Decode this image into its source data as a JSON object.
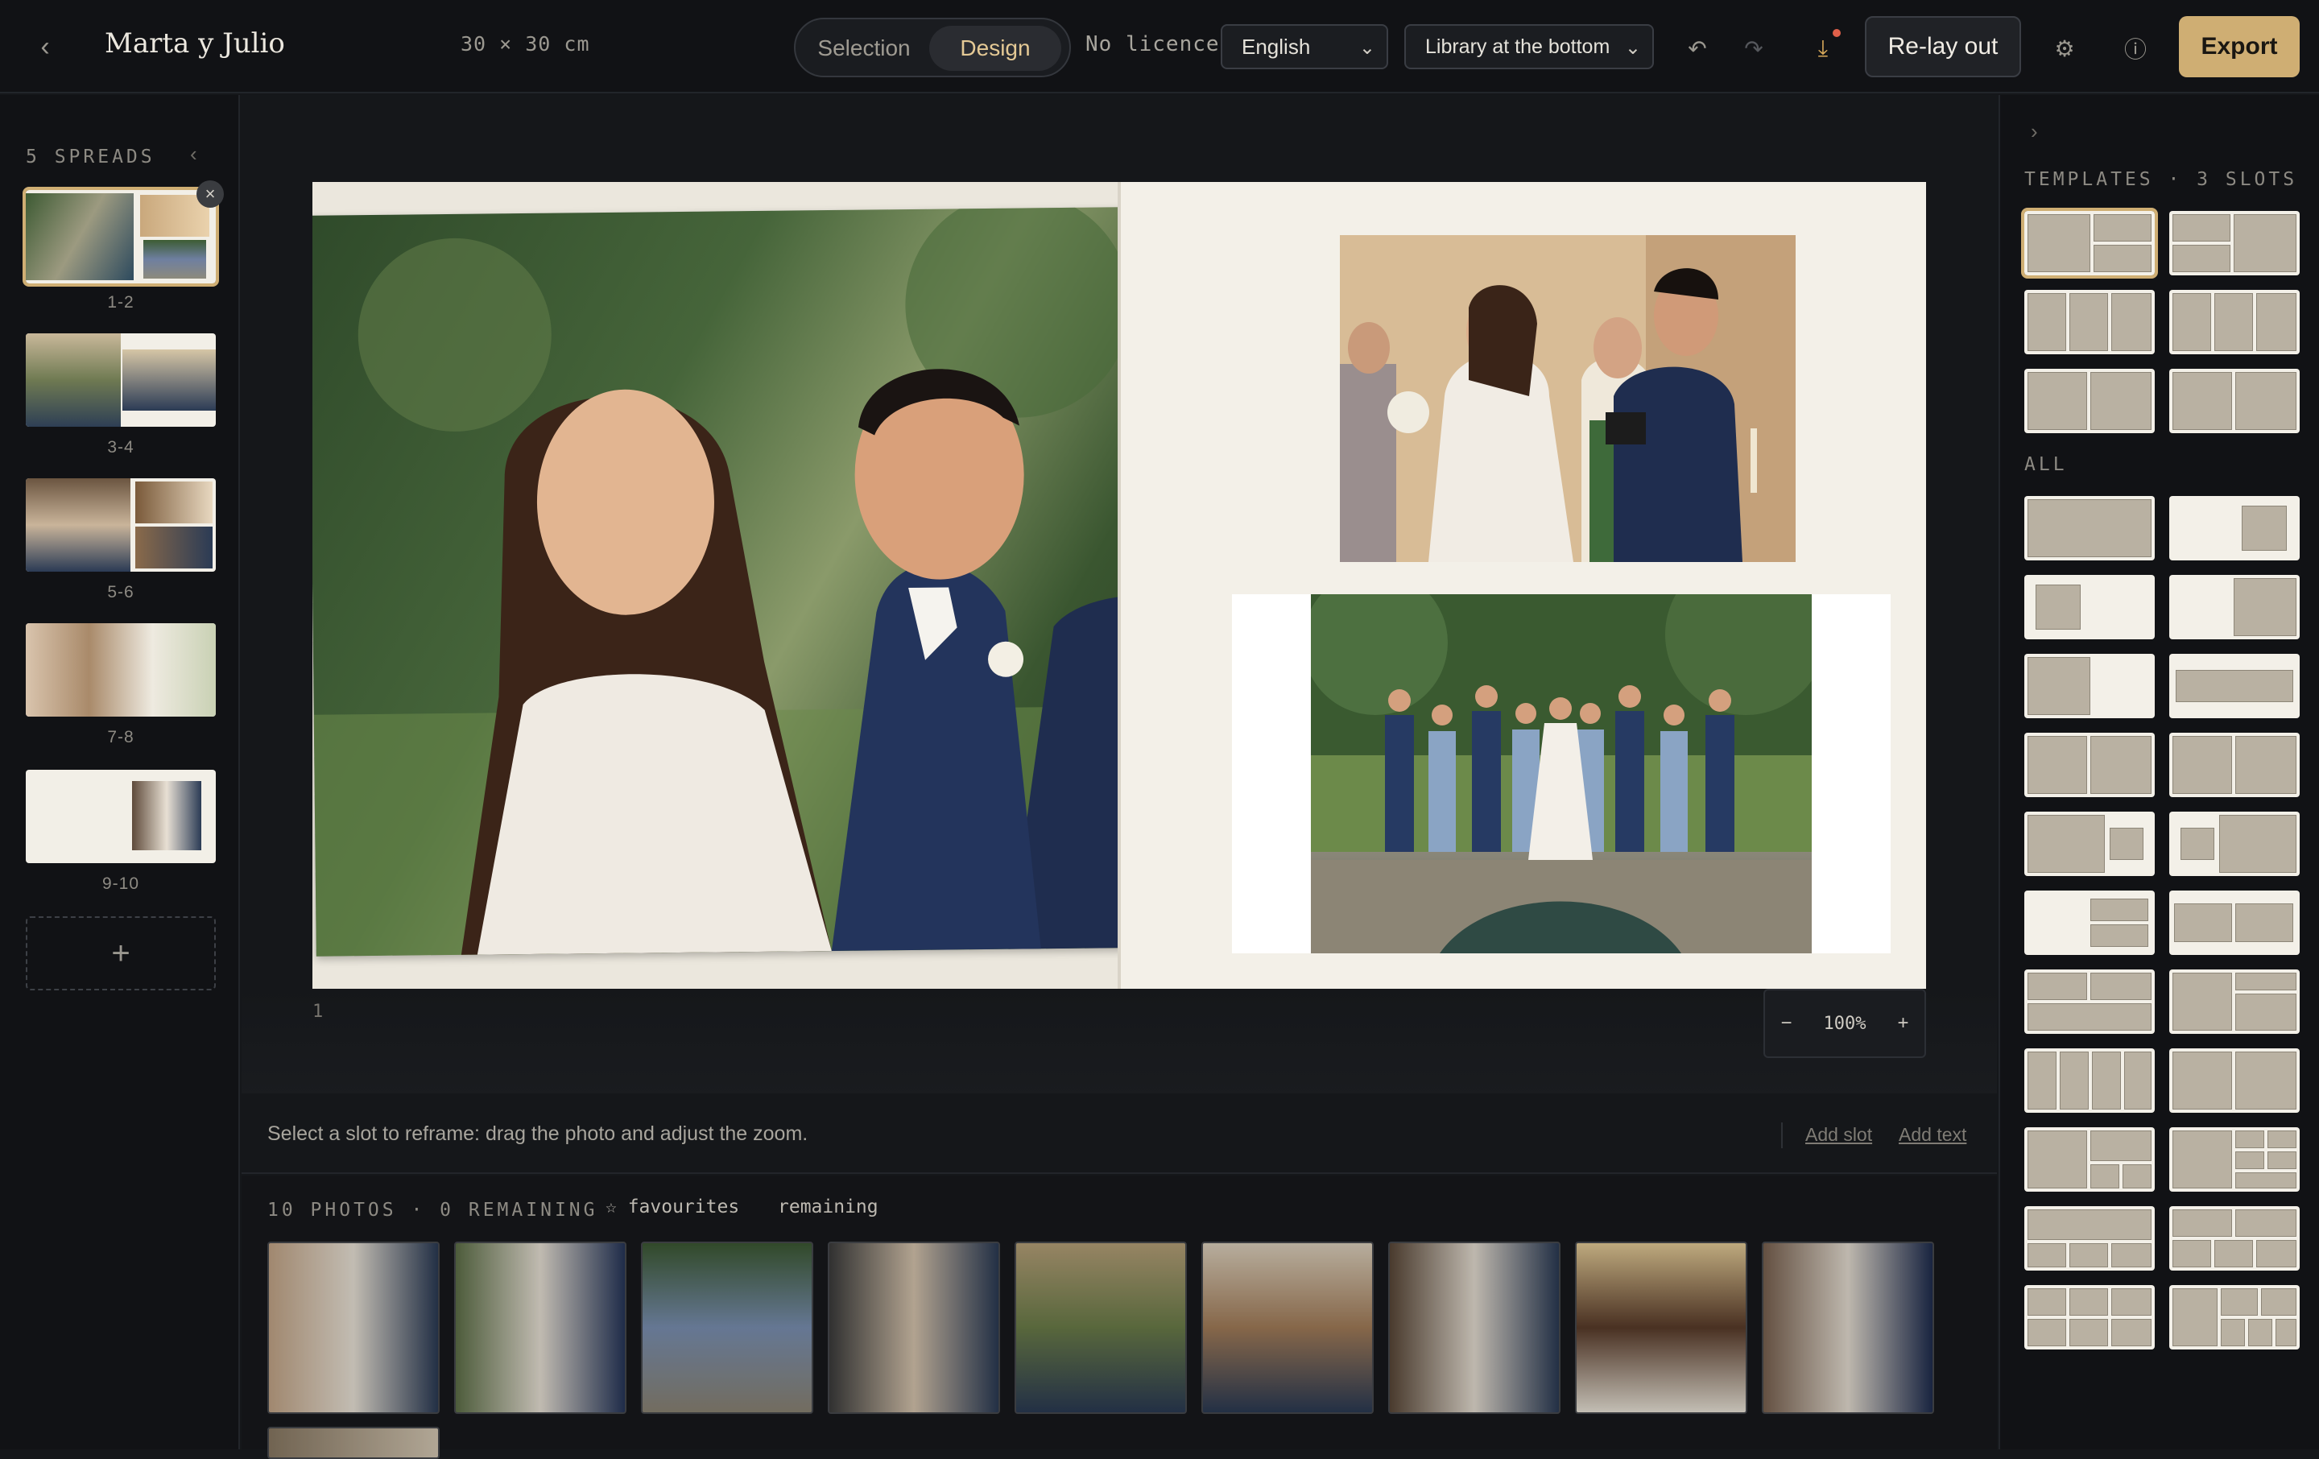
{
  "header": {
    "back_icon": "chevron-left-icon",
    "album_title": "Marta y Julio",
    "album_size": "30 × 30 cm",
    "modes": [
      {
        "label": "Selection",
        "active": false
      },
      {
        "label": "Design",
        "active": true
      }
    ],
    "licence": "No licence",
    "language": "English",
    "library_position": "Library at the bottom",
    "relayout_label": "Re-lay out",
    "export_label": "Export",
    "icons": [
      "undo-icon",
      "redo-icon",
      "download-icon",
      "gear-icon",
      "help-icon"
    ],
    "accent_color": "#cfae73"
  },
  "left_sidebar": {
    "title": "5 SPREADS",
    "spreads": [
      {
        "label": "1-2",
        "active": true
      },
      {
        "label": "3-4",
        "active": false
      },
      {
        "label": "5-6",
        "active": false
      },
      {
        "label": "7-8",
        "active": false
      },
      {
        "label": "9-10",
        "active": false
      }
    ],
    "add_label": "+"
  },
  "canvas": {
    "page_number": "1",
    "zoom": "100%",
    "zoom_out": "−",
    "zoom_in": "+"
  },
  "hint_bar": {
    "text": "Select a slot to reframe: drag the photo and adjust the zoom.",
    "add_slot": "Add slot",
    "add_text": "Add text"
  },
  "library": {
    "title": "10 PHOTOS · 0 REMAINING",
    "favourites": "☆ favourites",
    "remaining": "remaining"
  },
  "right_sidebar": {
    "templates_title": "TEMPLATES · 3 SLOTS",
    "all_title": "ALL"
  }
}
